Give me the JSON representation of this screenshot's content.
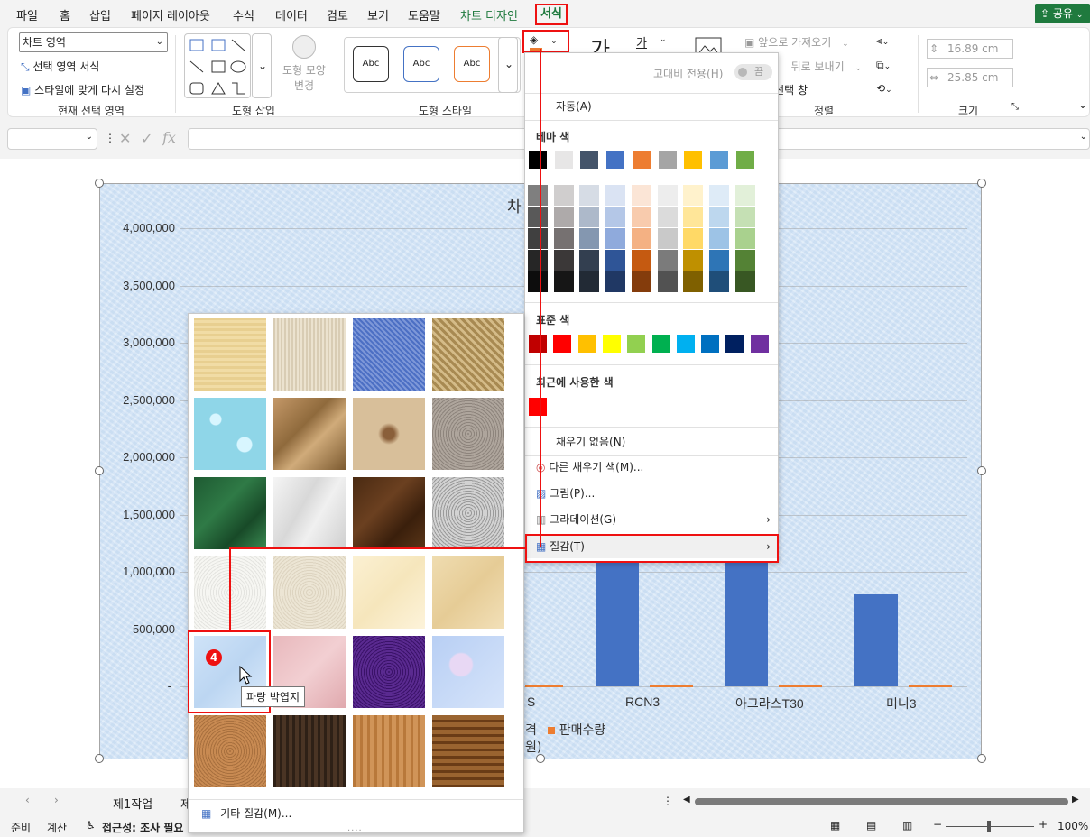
{
  "tabs": [
    "파일",
    "홈",
    "삽입",
    "페이지 레이아웃",
    "수식",
    "데이터",
    "검토",
    "보기",
    "도움말",
    "차트 디자인",
    "서식"
  ],
  "share_label": "공유",
  "ribbon": {
    "current_selection": {
      "combo_value": "차트 영역",
      "format_selection": "선택 영역 서식",
      "reset_style": "스타일에 맞게 다시 설정",
      "label": "현재 선택 영역"
    },
    "insert_shapes": {
      "change_shape": "도형 모양",
      "change_shape2": "변경",
      "label": "도형 삽입"
    },
    "shape_styles": {
      "abc": [
        "Abc",
        "Abc",
        "Abc"
      ],
      "label": "도형 스타일"
    },
    "arrange": {
      "bring_forward": "앞으로 가져오기",
      "send_backward": "뒤로 보내기",
      "selection_pane": "선택 창",
      "label": "정렬"
    },
    "size": {
      "height": "16.89 cm",
      "width": "25.85 cm",
      "label": "크기"
    }
  },
  "chart": {
    "title_partial": "차",
    "yticks": [
      "4,000,000",
      "3,500,000",
      "3,000,000",
      "2,500,000",
      "2,000,000",
      "1,500,000",
      "1,000,000",
      "500,000",
      "-"
    ],
    "x_labels": [
      "S",
      "RCN3",
      "아그라스T30",
      "미니3"
    ],
    "legend_partial": "격",
    "legend_series": "판매수량",
    "legend_unit_partial": "원)"
  },
  "chart_data": {
    "type": "bar",
    "categories": [
      "RCN3",
      "아그라스T30",
      "미니3"
    ],
    "series": [
      {
        "name": "판매수량",
        "values": [
          0,
          0,
          0
        ]
      }
    ],
    "visible_bar_values": [
      1100000,
      1100000,
      800000
    ],
    "ylim": [
      0,
      4000000
    ]
  },
  "color_menu": {
    "high_contrast": "고대비 전용(H)",
    "toggle": "끔",
    "auto": "자동(A)",
    "theme_colors": "테마 색",
    "standard_colors": "표준 색",
    "recent_colors": "최근에 사용한 색",
    "no_fill": "채우기 없음(N)",
    "more_colors": "다른 채우기 색(M)...",
    "picture": "그림(P)...",
    "gradient": "그라데이션(G)",
    "texture": "질감(T)",
    "theme_top": [
      "#000000",
      "#e7e6e6",
      "#44546a",
      "#4472c4",
      "#ed7d31",
      "#a5a5a5",
      "#ffc000",
      "#5b9bd5",
      "#70ad47"
    ],
    "standard": [
      "#c00000",
      "#ff0000",
      "#ffc000",
      "#ffff00",
      "#92d050",
      "#00b050",
      "#00b0f0",
      "#0070c0",
      "#002060",
      "#7030a0"
    ],
    "recent": [
      "#ff0000"
    ]
  },
  "texture_panel": {
    "more_textures": "기타 질감(M)...",
    "tooltip": "파랑 박엽지",
    "badge": "4",
    "names": [
      "파피루스",
      "캔버스",
      "데님",
      "짠 천",
      "물방울",
      "종이 가방",
      "화석",
      "모래",
      "녹색 대리석",
      "흰색 대리석",
      "갈색 대리석",
      "화강암",
      "신문 용지",
      "재생 용지",
      "양피지",
      "편지지",
      "파랑 박엽지",
      "분홍 박엽지",
      "자주 메시",
      "꽃다발",
      "코르크",
      "호두",
      "오크",
      "중간 나무"
    ]
  },
  "sheet": {
    "tab1": "제1작업",
    "tab2_partial": "제"
  },
  "status": {
    "ready": "준비",
    "calc": "계산",
    "accessibility": "접근성: 조사 필요",
    "zoom": "100%"
  }
}
